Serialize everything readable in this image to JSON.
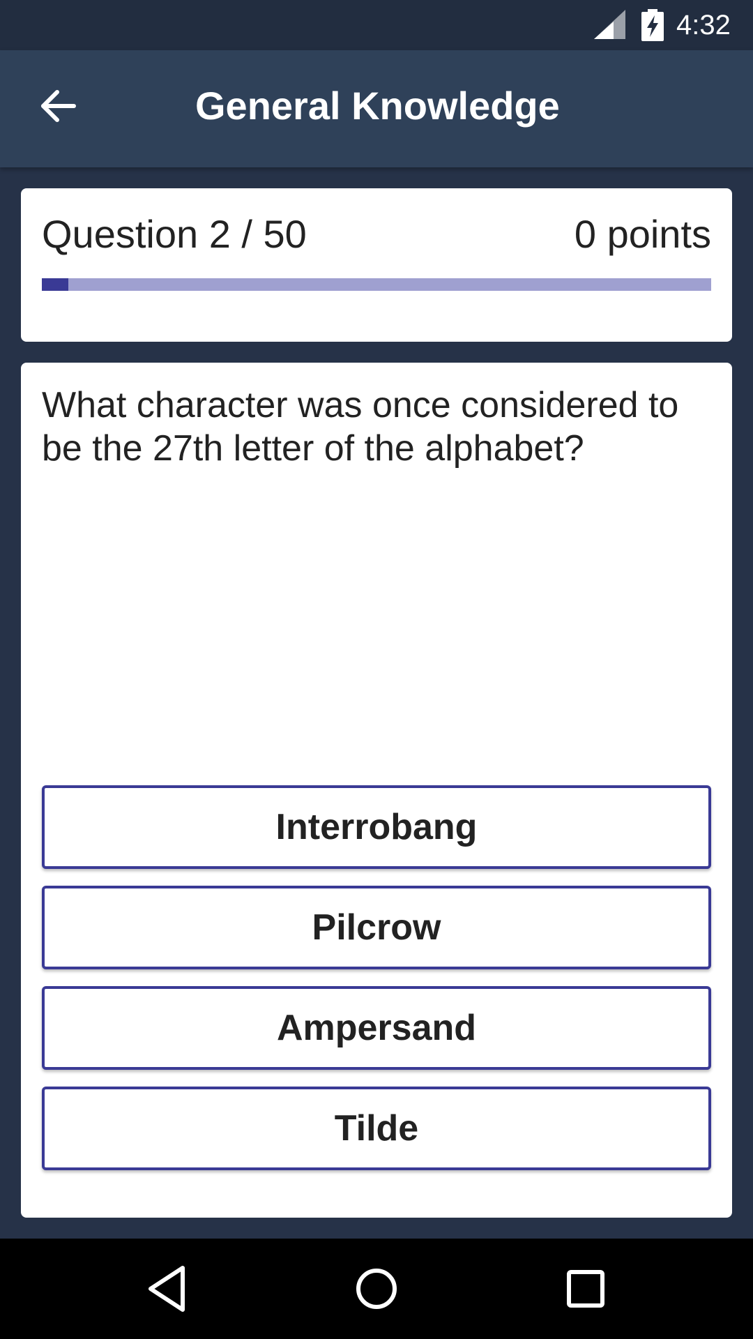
{
  "status_bar": {
    "time": "4:32",
    "icons": [
      "cell-signal-icon",
      "battery-charging-icon"
    ]
  },
  "app_bar": {
    "title": "General Knowledge",
    "back_icon": "arrow-back-icon"
  },
  "progress": {
    "question_label": "Question 2 / 50",
    "points_label": "0 points",
    "fraction_complete": 0.04,
    "colors": {
      "track": "#9fa0d0",
      "fill": "#3a3a95"
    }
  },
  "question": {
    "text": "What character was once considered to be the 27th letter of the alphabet?"
  },
  "answers": [
    {
      "label": "Interrobang"
    },
    {
      "label": "Pilcrow"
    },
    {
      "label": "Ampersand"
    },
    {
      "label": "Tilde"
    }
  ],
  "colors": {
    "background": "#263248",
    "app_bar": "#2f4159",
    "accent": "#3a3a95"
  },
  "nav_bar": {
    "icons": [
      "back-triangle-icon",
      "home-circle-icon",
      "recents-square-icon"
    ]
  }
}
